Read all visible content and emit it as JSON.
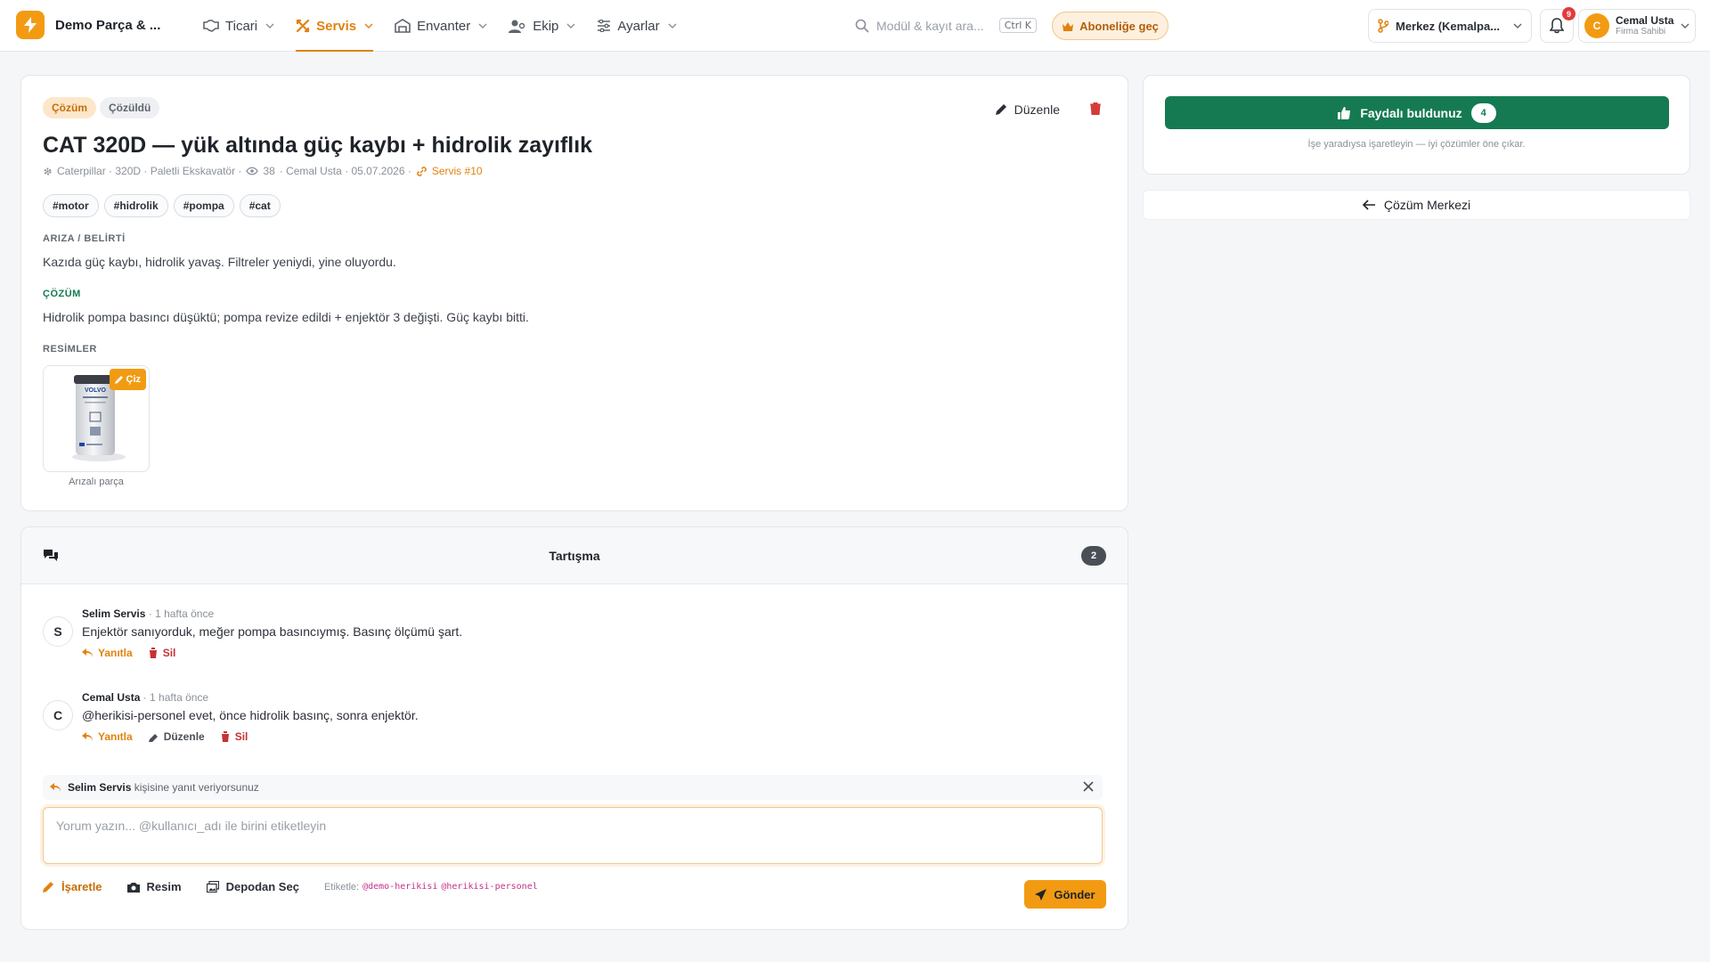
{
  "app": {
    "brand": "Demo Parça & ..."
  },
  "nav": {
    "items": [
      {
        "label": "Ticari",
        "icon": "handshake-icon"
      },
      {
        "label": "Servis",
        "icon": "tools-icon",
        "active": true
      },
      {
        "label": "Envanter",
        "icon": "warehouse-icon"
      },
      {
        "label": "Ekip",
        "icon": "users-icon"
      },
      {
        "label": "Ayarlar",
        "icon": "sliders-icon"
      }
    ]
  },
  "search": {
    "placeholder": "Modül & kayıt ara...",
    "shortcut": "Ctrl K"
  },
  "upgrade": {
    "label": "Aboneliğe geç"
  },
  "branch": {
    "label": "Merkez (Kemalpa..."
  },
  "notifications": {
    "count": "9"
  },
  "user": {
    "initial": "C",
    "name": "Cemal Usta",
    "role": "Firma Sahibi"
  },
  "solution": {
    "badges": [
      "Çözüm",
      "Çözüldü"
    ],
    "edit_label": "Düzenle",
    "title": "CAT 320D — yük altında güç kaybı + hidrolik zayıflık",
    "meta": {
      "machine": "Caterpillar · 320D · Paletli Ekskavatör ·",
      "views": "38",
      "author_date": "· Cemal Usta · 05.07.2026 ·",
      "service_link": "Servis #10"
    },
    "tags": [
      "#motor",
      "#hidrolik",
      "#pompa",
      "#cat"
    ],
    "fault_label": "ARIZA / BELİRTİ",
    "fault_text": "Kazıda güç kaybı, hidrolik yavaş. Filtreler yeniydi, yine oluyordu.",
    "solution_label": "ÇÖZÜM",
    "solution_text": "Hidrolik pompa basıncı düşüktü; pompa revize edildi + enjektör 3 değişti. Güç kaybı bitti.",
    "images_label": "RESİMLER",
    "image": {
      "draw_label": "Çiz",
      "caption": "Arızalı parça",
      "brand": "VOLVO"
    }
  },
  "discussion": {
    "title": "Tartışma",
    "count": "2",
    "comments": [
      {
        "initial": "S",
        "author": "Selim Servis",
        "time": "· 1 hafta önce",
        "text": "Enjektör sanıyorduk, meğer pompa basıncıymış. Basınç ölçümü şart.",
        "actions": {
          "reply": "Yanıtla",
          "delete": "Sil"
        }
      },
      {
        "initial": "C",
        "author": "Cemal Usta",
        "time": "· 1 hafta önce",
        "text": "@herikisi-personel evet, önce hidrolik basınç, sonra enjektör.",
        "actions": {
          "reply": "Yanıtla",
          "edit": "Düzenle",
          "delete": "Sil"
        }
      }
    ],
    "reply_to": {
      "name": "Selim Servis",
      "suffix": "kişisine yanıt veriyorsunuz"
    },
    "input_placeholder": "Yorum yazın... @kullanıcı_adı ile birini etiketleyin",
    "tools": {
      "mark": "İşaretle",
      "image": "Resim",
      "storage": "Depodan Seç"
    },
    "tag_hint": {
      "label": "Etiketle:",
      "users": [
        "@demo-herikisi",
        "@herikisi-personel"
      ]
    },
    "send_label": "Gönder"
  },
  "sidebar": {
    "useful_label": "Faydalı buldunuz",
    "useful_count": "4",
    "useful_hint": "İşe yaradıysa işaretleyin — iyi çözümler öne çıkar.",
    "back_label": "Çözüm Merkezi"
  },
  "colors": {
    "accent": "#f29b12",
    "accent_text": "#e2820e",
    "success": "#157a52",
    "danger": "#c63232"
  }
}
